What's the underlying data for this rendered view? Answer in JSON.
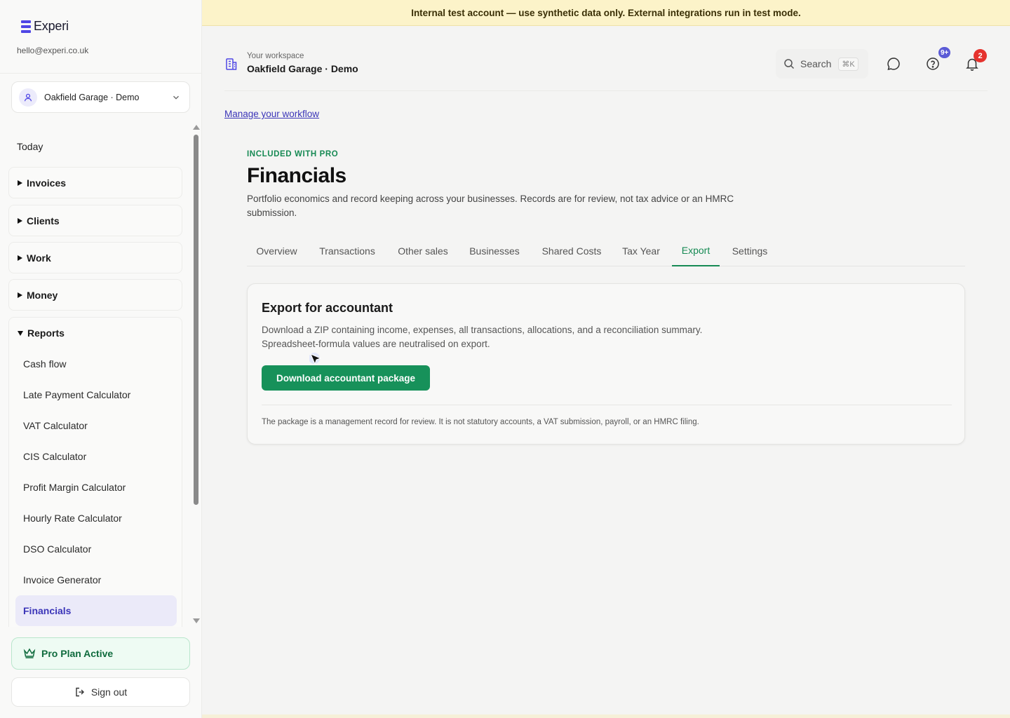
{
  "brand": {
    "name": "Experi",
    "email": "hello@experi.co.uk",
    "accent": "#4f46e5"
  },
  "workspace_select": {
    "label": "Oakfield Garage · Demo"
  },
  "sidebar": {
    "today": "Today",
    "groups": [
      {
        "label": "Invoices",
        "expanded": false
      },
      {
        "label": "Clients",
        "expanded": false
      },
      {
        "label": "Work",
        "expanded": false
      },
      {
        "label": "Money",
        "expanded": false
      }
    ],
    "reports": {
      "label": "Reports",
      "expanded": true,
      "items": [
        "Cash flow",
        "Late Payment Calculator",
        "VAT Calculator",
        "CIS Calculator",
        "Profit Margin Calculator",
        "Hourly Rate Calculator",
        "DSO Calculator",
        "Invoice Generator",
        "Financials"
      ],
      "active": "Financials"
    },
    "pro_plan": "Pro Plan Active",
    "sign_out": "Sign out"
  },
  "banner": {
    "text": "Internal test account — use synthetic data only. External integrations run in test mode."
  },
  "header": {
    "workspace_caption": "Your workspace",
    "workspace_name": "Oakfield Garage · Demo",
    "search_label": "Search",
    "search_shortcut": "⌘K",
    "help_badge": "9+",
    "notifications_badge": "2"
  },
  "main": {
    "manage_link": "Manage your workflow",
    "eyebrow": "INCLUDED WITH PRO",
    "title": "Financials",
    "description": "Portfolio economics and record keeping across your businesses. Records are for review, not tax advice or an HMRC submission.",
    "tabs": [
      "Overview",
      "Transactions",
      "Other sales",
      "Businesses",
      "Shared Costs",
      "Tax Year",
      "Export",
      "Settings"
    ],
    "active_tab": "Export",
    "card": {
      "title": "Export for accountant",
      "description": "Download a ZIP containing income, expenses, all transactions, allocations, and a reconciliation summary. Spreadsheet-formula values are neutralised on export.",
      "button": "Download accountant package",
      "note": "The package is a management record for review. It is not statutory accounts, a VAT submission, payroll, or an HMRC filing."
    }
  },
  "colors": {
    "green": "#17915a",
    "indigo": "#3b35b8",
    "banner": "#fcf3c9",
    "badge_indigo": "#5b5bd6",
    "badge_red": "#e5322d"
  }
}
